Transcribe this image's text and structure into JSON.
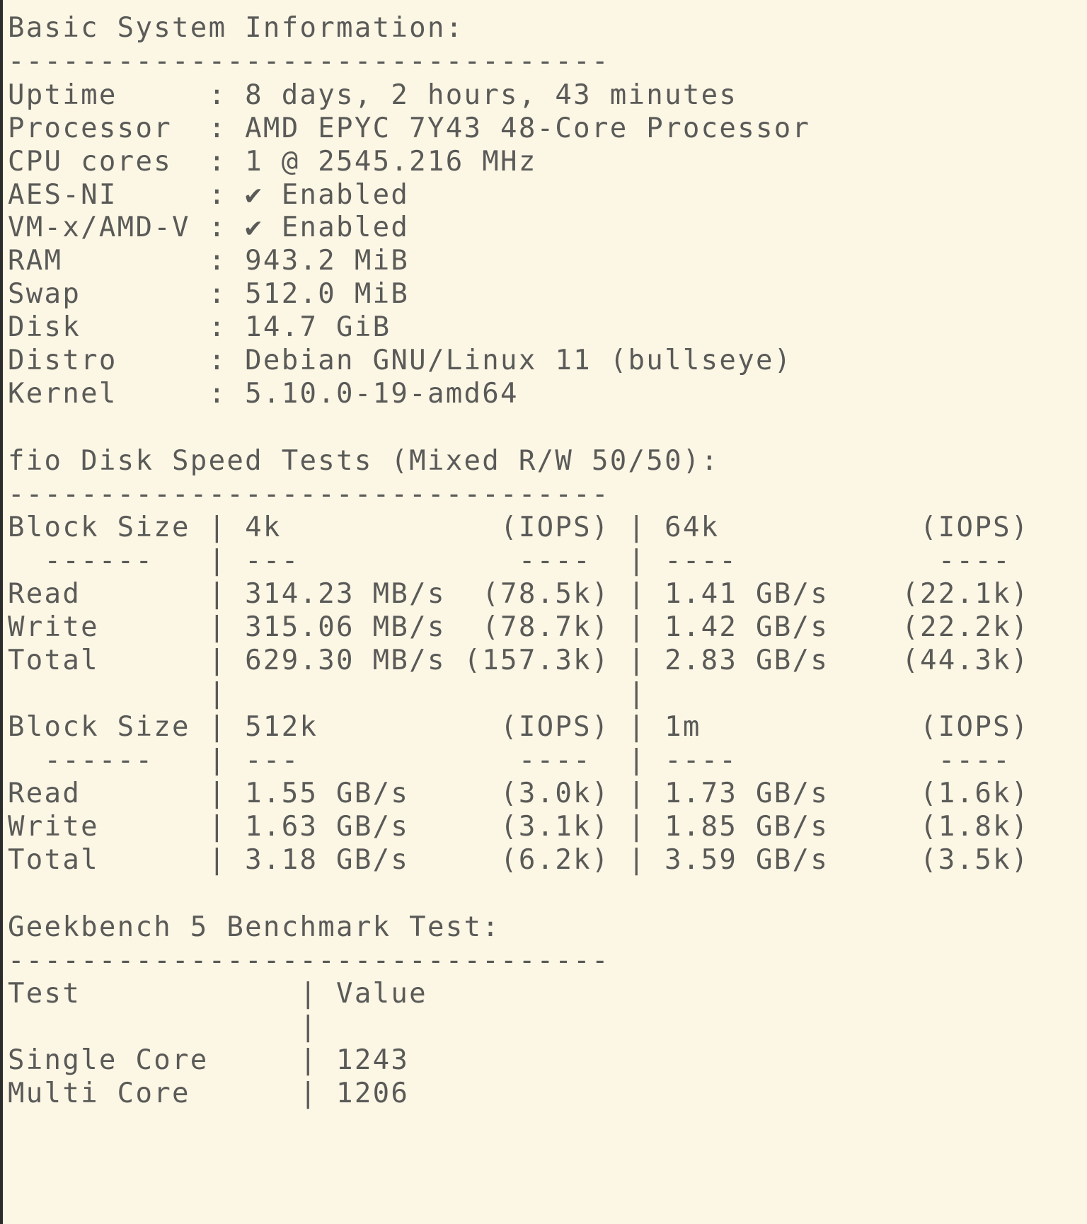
{
  "terminal": {
    "lines": [
      "Basic System Information:",
      "---------------------------------",
      "Uptime     : 8 days, 2 hours, 43 minutes",
      "Processor  : AMD EPYC 7Y43 48-Core Processor",
      "CPU cores  : 1 @ 2545.216 MHz",
      "AES-NI     : ✔ Enabled",
      "VM-x/AMD-V : ✔ Enabled",
      "RAM        : 943.2 MiB",
      "Swap       : 512.0 MiB",
      "Disk       : 14.7 GiB",
      "Distro     : Debian GNU/Linux 11 (bullseye)",
      "Kernel     : 5.10.0-19-amd64",
      "",
      "fio Disk Speed Tests (Mixed R/W 50/50):",
      "---------------------------------",
      "Block Size | 4k            (IOPS) | 64k           (IOPS)",
      "  ------   | ---            ----  | ----           ----",
      "Read       | 314.23 MB/s  (78.5k) | 1.41 GB/s    (22.1k)",
      "Write      | 315.06 MB/s  (78.7k) | 1.42 GB/s    (22.2k)",
      "Total      | 629.30 MB/s (157.3k) | 2.83 GB/s    (44.3k)",
      "           |                      |",
      "Block Size | 512k          (IOPS) | 1m            (IOPS)",
      "  ------   | ---            ----  | ----           ----",
      "Read       | 1.55 GB/s     (3.0k) | 1.73 GB/s     (1.6k)",
      "Write      | 1.63 GB/s     (3.1k) | 1.85 GB/s     (1.8k)",
      "Total      | 3.18 GB/s     (6.2k) | 3.59 GB/s     (3.5k)",
      "",
      "Geekbench 5 Benchmark Test:",
      "---------------------------------",
      "Test            | Value",
      "                |",
      "Single Core     | 1243",
      "Multi Core      | 1206"
    ]
  }
}
